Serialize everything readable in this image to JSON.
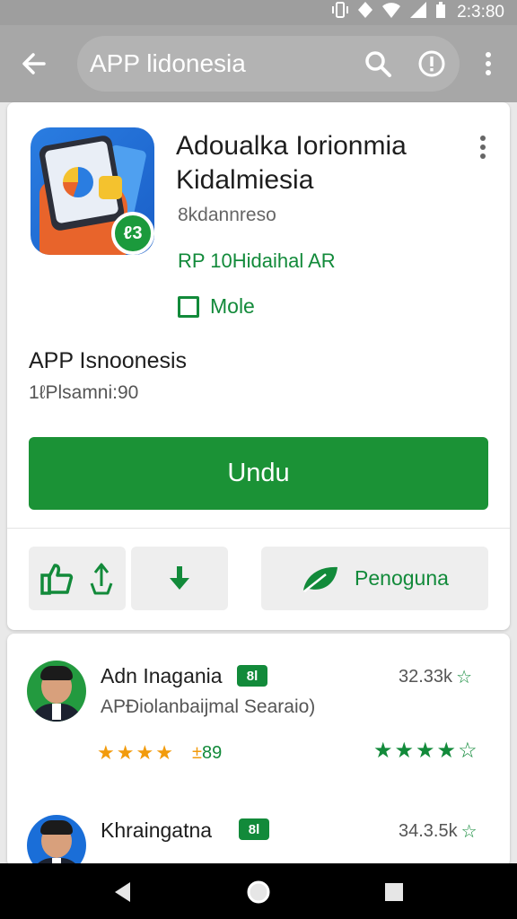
{
  "status_bar": {
    "time": "2:3:80",
    "icons": [
      "vibrate-icon",
      "location-icon",
      "wifi-icon",
      "signal-icon",
      "battery-icon"
    ]
  },
  "app_bar": {
    "search_text": "APP lidonesia",
    "icons": [
      "back-arrow-icon",
      "search-icon",
      "info-icon",
      "more-vert-icon"
    ]
  },
  "app": {
    "title": "Adoualka Iorionmia Kidalmiesia",
    "developer": "8kdannreso",
    "ad_line": "RP 10Hidaihal AR",
    "wishlist_label": "Mole",
    "name_subtitle": "APP Isnoonesis",
    "size_text": "1ℓPlsamni:90",
    "badge_text": "ℓ3",
    "install_label": "Undu",
    "secondary_action_label": "Penoguna",
    "accent_color": "#1b9236"
  },
  "reviews": [
    {
      "name": "Adn Inagania",
      "tag": "8l",
      "count": "32.33k",
      "subtitle": "APÐiolanbaijmal Searaio)",
      "score": "89",
      "orange_stars": 4,
      "green_rating_filled": 4,
      "green_rating_total": 5
    },
    {
      "name": "Khraingatna",
      "tag": "8l",
      "count": "34.3.5k"
    }
  ],
  "nav_bar": {
    "icons": [
      "nav-back-icon",
      "nav-home-icon",
      "nav-recents-icon"
    ]
  }
}
